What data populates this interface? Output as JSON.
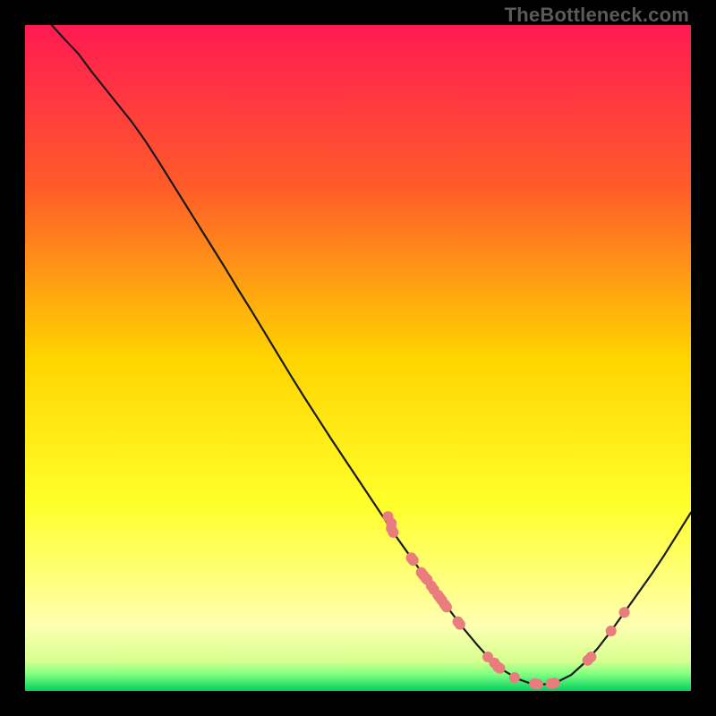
{
  "watermark": "TheBottleneck.com",
  "chart_data": {
    "type": "line",
    "title": "",
    "xlabel": "",
    "ylabel": "",
    "xlim": [
      0,
      100
    ],
    "ylim": [
      0,
      100
    ],
    "gradient_stops": [
      {
        "offset": 0,
        "color": "#ff1a52"
      },
      {
        "offset": 24,
        "color": "#ff5a2a"
      },
      {
        "offset": 50,
        "color": "#ffd400"
      },
      {
        "offset": 72,
        "color": "#ffff2a"
      },
      {
        "offset": 90,
        "color": "#ffffb0"
      },
      {
        "offset": 95.5,
        "color": "#d8ff90"
      },
      {
        "offset": 97.5,
        "color": "#80ff80"
      },
      {
        "offset": 100,
        "color": "#00d060"
      }
    ],
    "curve": [
      {
        "x": 4.0,
        "y": 100.0
      },
      {
        "x": 6.0,
        "y": 97.8
      },
      {
        "x": 8.0,
        "y": 95.7
      },
      {
        "x": 10.0,
        "y": 93.0
      },
      {
        "x": 12.0,
        "y": 90.5
      },
      {
        "x": 14.0,
        "y": 88.0
      },
      {
        "x": 16.0,
        "y": 85.5
      },
      {
        "x": 18.0,
        "y": 82.7
      },
      {
        "x": 20.0,
        "y": 79.6
      },
      {
        "x": 22.0,
        "y": 76.4
      },
      {
        "x": 24.0,
        "y": 73.2
      },
      {
        "x": 26.0,
        "y": 70.0
      },
      {
        "x": 28.0,
        "y": 66.8
      },
      {
        "x": 30.0,
        "y": 63.6
      },
      {
        "x": 32.0,
        "y": 60.3
      },
      {
        "x": 34.0,
        "y": 57.1
      },
      {
        "x": 36.0,
        "y": 53.8
      },
      {
        "x": 38.0,
        "y": 50.5
      },
      {
        "x": 40.0,
        "y": 47.2
      },
      {
        "x": 42.0,
        "y": 44.0
      },
      {
        "x": 44.0,
        "y": 40.9
      },
      {
        "x": 46.0,
        "y": 37.8
      },
      {
        "x": 48.0,
        "y": 34.8
      },
      {
        "x": 50.0,
        "y": 31.8
      },
      {
        "x": 52.0,
        "y": 28.8
      },
      {
        "x": 54.0,
        "y": 25.8
      },
      {
        "x": 56.0,
        "y": 22.8
      },
      {
        "x": 58.0,
        "y": 20.0
      },
      {
        "x": 60.0,
        "y": 17.2
      },
      {
        "x": 62.0,
        "y": 14.4
      },
      {
        "x": 64.0,
        "y": 11.8
      },
      {
        "x": 66.0,
        "y": 9.2
      },
      {
        "x": 68.0,
        "y": 6.8
      },
      {
        "x": 70.0,
        "y": 4.6
      },
      {
        "x": 72.0,
        "y": 3.0
      },
      {
        "x": 74.0,
        "y": 1.8
      },
      {
        "x": 76.0,
        "y": 1.1
      },
      {
        "x": 78.0,
        "y": 1.0
      },
      {
        "x": 80.0,
        "y": 1.4
      },
      {
        "x": 82.0,
        "y": 2.4
      },
      {
        "x": 84.0,
        "y": 4.2
      },
      {
        "x": 86.0,
        "y": 6.4
      },
      {
        "x": 88.0,
        "y": 9.0
      },
      {
        "x": 90.0,
        "y": 11.8
      },
      {
        "x": 92.0,
        "y": 14.6
      },
      {
        "x": 94.0,
        "y": 17.4
      },
      {
        "x": 96.0,
        "y": 20.4
      },
      {
        "x": 98.0,
        "y": 23.6
      },
      {
        "x": 100.0,
        "y": 26.8
      }
    ],
    "points": [
      {
        "x": 54.5,
        "y": 26.2
      },
      {
        "x": 55.0,
        "y": 25.2
      },
      {
        "x": 55.0,
        "y": 24.4
      },
      {
        "x": 55.3,
        "y": 23.8
      },
      {
        "x": 58.0,
        "y": 20.0
      },
      {
        "x": 58.3,
        "y": 19.6
      },
      {
        "x": 59.5,
        "y": 17.8
      },
      {
        "x": 59.8,
        "y": 17.4
      },
      {
        "x": 60.2,
        "y": 16.9
      },
      {
        "x": 60.4,
        "y": 16.7
      },
      {
        "x": 61.0,
        "y": 15.8
      },
      {
        "x": 61.4,
        "y": 15.2
      },
      {
        "x": 62.0,
        "y": 14.4
      },
      {
        "x": 62.3,
        "y": 14.0
      },
      {
        "x": 62.6,
        "y": 13.6
      },
      {
        "x": 63.0,
        "y": 13.0
      },
      {
        "x": 63.3,
        "y": 12.6
      },
      {
        "x": 65.0,
        "y": 10.4
      },
      {
        "x": 65.3,
        "y": 10.0
      },
      {
        "x": 69.5,
        "y": 5.1
      },
      {
        "x": 70.5,
        "y": 4.2
      },
      {
        "x": 71.0,
        "y": 3.6
      },
      {
        "x": 71.3,
        "y": 3.4
      },
      {
        "x": 73.5,
        "y": 2.0
      },
      {
        "x": 76.5,
        "y": 1.1
      },
      {
        "x": 77.0,
        "y": 1.0
      },
      {
        "x": 79.0,
        "y": 1.1
      },
      {
        "x": 79.5,
        "y": 1.2
      },
      {
        "x": 84.5,
        "y": 4.6
      },
      {
        "x": 85.0,
        "y": 5.1
      },
      {
        "x": 88.0,
        "y": 9.0
      },
      {
        "x": 90.0,
        "y": 11.8
      }
    ],
    "point_color": "#e97c7c",
    "point_radius": 6,
    "line_color": "#1a1a1a",
    "line_width": 2.2
  }
}
